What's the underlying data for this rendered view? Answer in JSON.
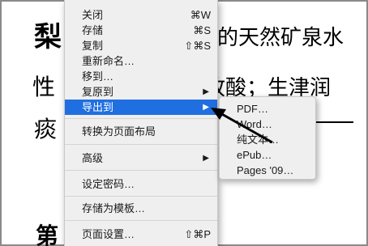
{
  "document": {
    "title_fragment": "梨",
    "title_right": "的天然矿泉水",
    "line2_left": "性",
    "line2_right": "故酸；生津润",
    "line3_left": "痰",
    "line3_end": "〈",
    "bottom_fragment": "第"
  },
  "menu": {
    "items": [
      {
        "label": "关闭",
        "shortcut": "⌘W"
      },
      {
        "label": "存储",
        "shortcut": "⌘S"
      },
      {
        "label": "复制",
        "shortcut": "⇧⌘S"
      },
      {
        "label": "重新命名…",
        "shortcut": ""
      },
      {
        "label": "移到…",
        "shortcut": ""
      },
      {
        "label": "复原到",
        "shortcut": ""
      },
      {
        "label": "导出到",
        "shortcut": ""
      },
      {
        "label": "转换为页面布局",
        "shortcut": ""
      },
      {
        "label": "高级",
        "shortcut": ""
      },
      {
        "label": "设定密码…",
        "shortcut": ""
      },
      {
        "label": "存储为模板…",
        "shortcut": ""
      },
      {
        "label": "页面设置…",
        "shortcut": "⇧⌘P"
      }
    ],
    "selected_label": "导出到",
    "selected_color": "#1f6fe0"
  },
  "submenu": {
    "items": [
      "PDF…",
      "Word…",
      "纯文本…",
      "ePub…",
      "Pages '09…"
    ]
  }
}
